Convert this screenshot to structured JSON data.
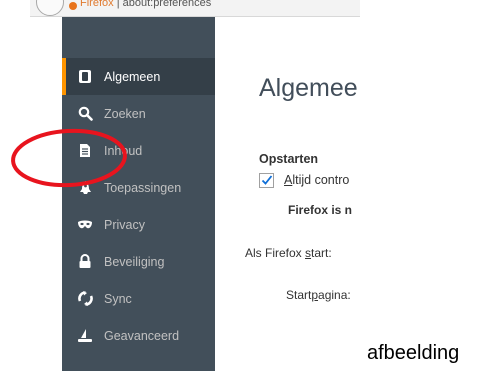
{
  "browser": {
    "tab_brand": "Firefox",
    "url": "about:preferences"
  },
  "sidebar": {
    "items": [
      {
        "label": "Algemeen",
        "icon": "general-icon"
      },
      {
        "label": "Zoeken",
        "icon": "search-icon"
      },
      {
        "label": "Inhoud",
        "icon": "content-icon"
      },
      {
        "label": "Toepassingen",
        "icon": "applications-icon"
      },
      {
        "label": "Privacy",
        "icon": "privacy-mask-icon"
      },
      {
        "label": "Beveiliging",
        "icon": "security-lock-icon"
      },
      {
        "label": "Sync",
        "icon": "sync-icon"
      },
      {
        "label": "Geavanceerd",
        "icon": "advanced-wizard-icon"
      }
    ],
    "selected": "Algemeen"
  },
  "main": {
    "title": "Algemee",
    "startup_section": "Opstarten",
    "default_check_prefix": "A",
    "default_check_rest": "ltijd contro",
    "default_checked": true,
    "default_warning": "Firefox is n",
    "on_start_prefix": "Als Firefox ",
    "on_start_key": "s",
    "on_start_rest": "tart:",
    "homepage_prefix": "Start",
    "homepage_key": "p",
    "homepage_rest": "agina:"
  },
  "annotation": {
    "caption": "afbeelding",
    "circle_color": "#e8141e"
  },
  "colors": {
    "sidebar_bg": "#424f5a",
    "selected_bg": "#343f48",
    "selected_accent": "#ff9500",
    "checkbox_mark": "#0f6fd8"
  }
}
